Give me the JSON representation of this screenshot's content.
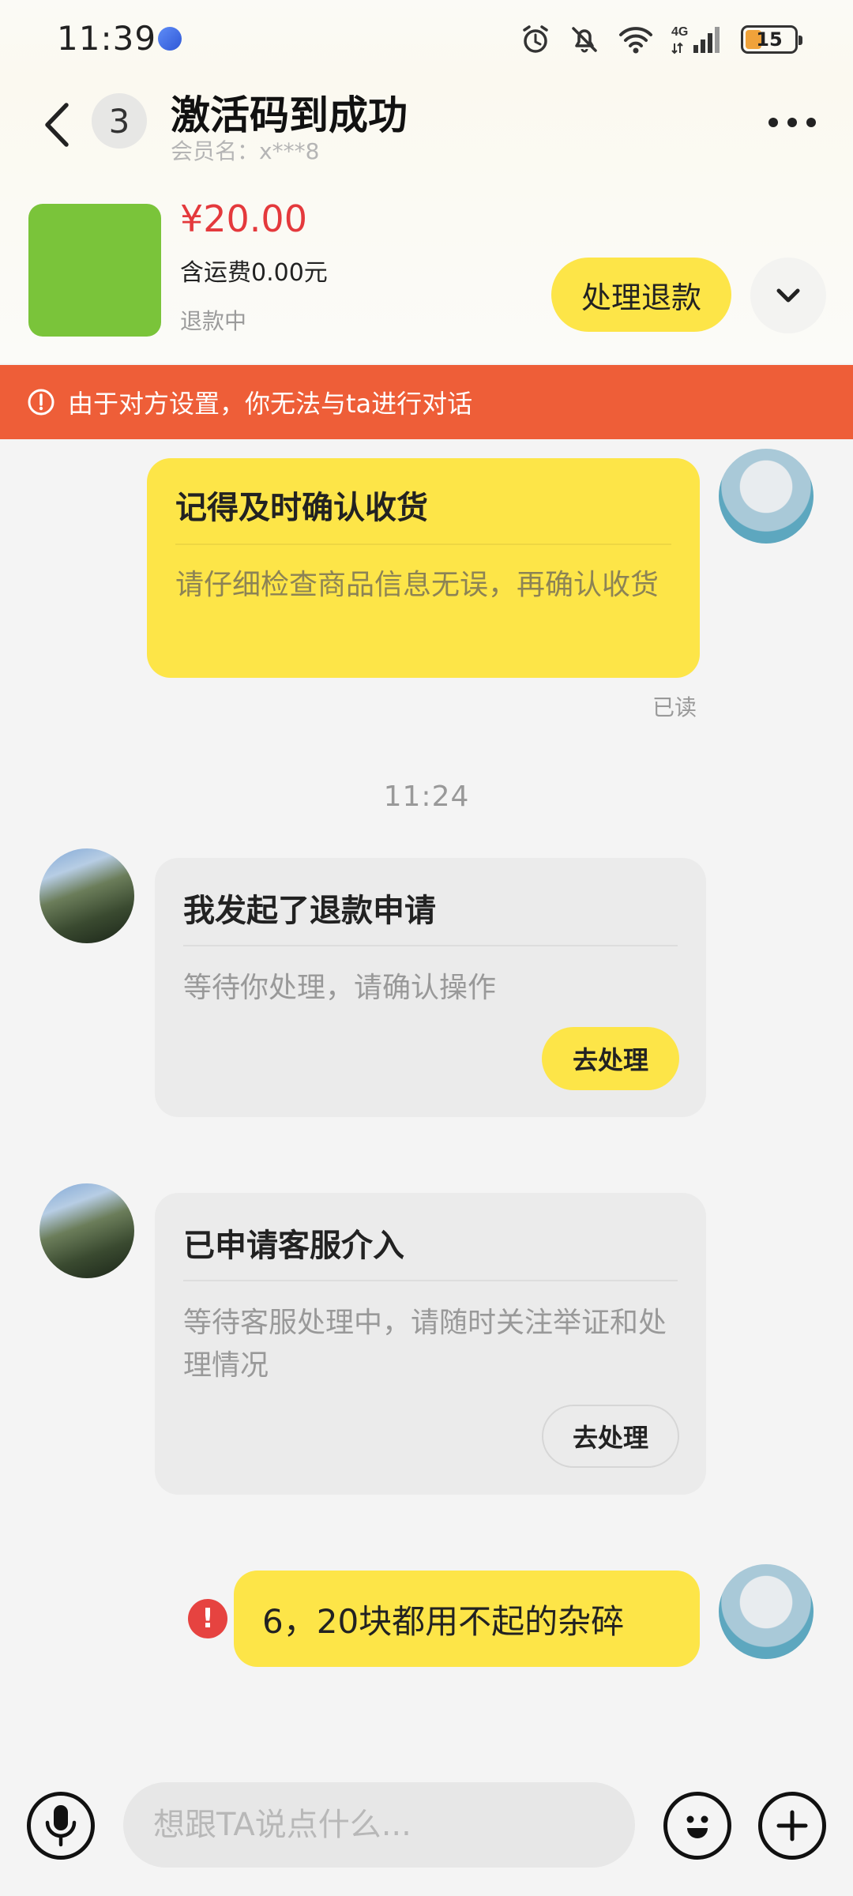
{
  "status_bar": {
    "time": "11:39",
    "battery": "15",
    "icons": [
      "alarm-icon",
      "mute-icon",
      "wifi-icon",
      "signal-4g-icon",
      "battery-icon"
    ]
  },
  "header": {
    "unread_count": "3",
    "title": "激活码到成功",
    "member_name": "会员名：x***8"
  },
  "order": {
    "price": "¥20.00",
    "shipping": "含运费0.00元",
    "status": "退款中",
    "refund_button": "处理退款",
    "thumb_color": "#7ac43a"
  },
  "banner": {
    "text": "由于对方设置，你无法与ta进行对话",
    "color": "#ee5e38"
  },
  "messages": {
    "m1": {
      "title": "记得及时确认收货",
      "text": "请仔细检查商品信息无误，再确认收货",
      "read": "已读"
    },
    "time_separator": "11:24",
    "m2": {
      "title": "我发起了退款申请",
      "text": "等待你处理，请确认操作",
      "button": "去处理"
    },
    "m3": {
      "title": "已申请客服介入",
      "text": "等待客服处理中，请随时关注举证和处理情况",
      "button": "去处理"
    },
    "m4": {
      "text": "6，20块都用不起的杂碎"
    }
  },
  "input": {
    "placeholder": "想跟TA说点什么..."
  },
  "colors": {
    "accent_yellow": "#fde548",
    "price_red": "#e4393c",
    "error_red": "#e64340"
  }
}
